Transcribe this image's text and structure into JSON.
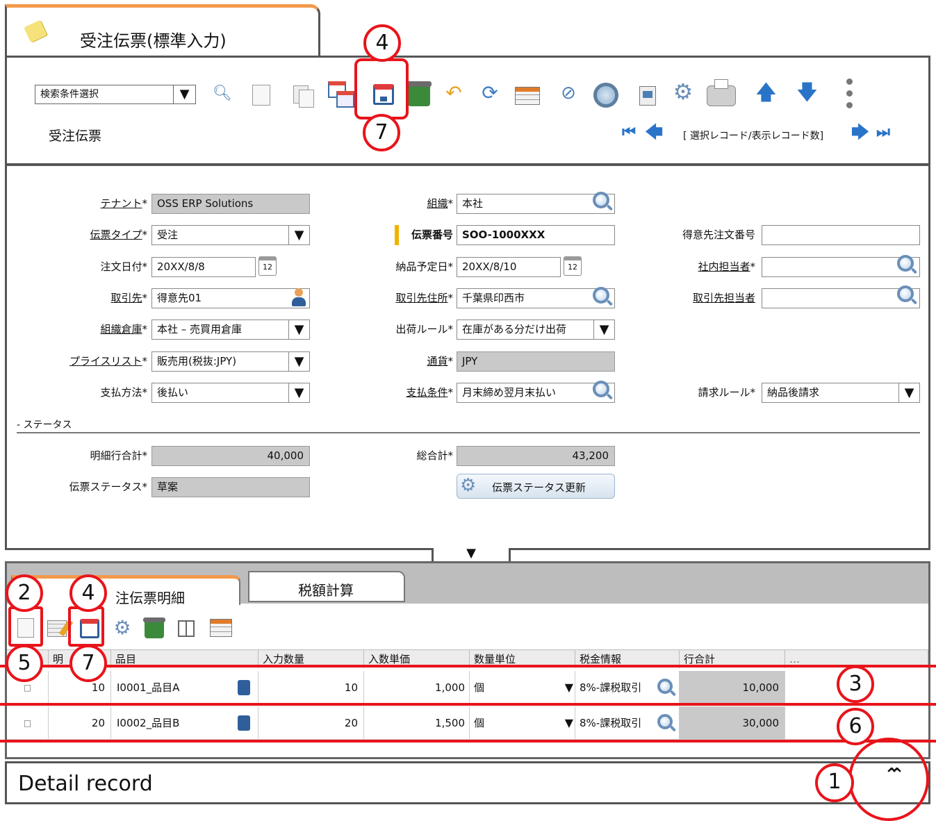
{
  "window": {
    "tab_title": "受注伝票(標準入力)",
    "form_title": "受注伝票"
  },
  "toolbar": {
    "search_select": "検索条件選択",
    "record_info": "[ 選択レコード/表示レコード数]"
  },
  "fields": {
    "tenant": {
      "label": "テナント",
      "value": "OSS ERP Solutions"
    },
    "org": {
      "label": "組織",
      "value": "本社"
    },
    "doc_type": {
      "label": "伝票タイプ",
      "value": "受注"
    },
    "doc_no": {
      "label": "伝票番号",
      "value": "SOO-1000XXX"
    },
    "customer_po": {
      "label": "得意先注文番号",
      "value": ""
    },
    "order_date": {
      "label": "注文日付",
      "value": "20XX/8/8"
    },
    "delivery_date": {
      "label": "納品予定日",
      "value": "20XX/8/10"
    },
    "sales_rep": {
      "label": "社内担当者",
      "value": ""
    },
    "partner": {
      "label": "取引先",
      "value": "得意先01"
    },
    "partner_addr": {
      "label": "取引先住所",
      "value": "千葉県印西市"
    },
    "partner_contact": {
      "label": "取引先担当者",
      "value": ""
    },
    "warehouse": {
      "label": "組織倉庫",
      "value": "本社 – 売買用倉庫"
    },
    "delivery_rule": {
      "label": "出荷ルール",
      "value": "在庫がある分だけ出荷"
    },
    "pricelist": {
      "label": "プライスリスト",
      "value": "販売用(税抜:JPY)"
    },
    "currency": {
      "label": "通貨",
      "value": "JPY"
    },
    "pay_method": {
      "label": "支払方法",
      "value": "後払い"
    },
    "pay_term": {
      "label": "支払条件",
      "value": "月末締め翌月末払い"
    },
    "invoice_rule": {
      "label": "請求ルール",
      "value": "納品後請求"
    },
    "status_section": "- ステータス",
    "lines_total": {
      "label": "明細行合計",
      "value": "40,000"
    },
    "grand_total": {
      "label": "総合計",
      "value": "43,200"
    },
    "doc_status": {
      "label": "伝票ステータス",
      "value": "草案"
    },
    "status_button": "伝票ステータス更新"
  },
  "required_mark": "*",
  "detail": {
    "tabs": [
      "注伝票明細",
      "税額計算"
    ],
    "columns": [
      "明",
      "品目",
      "入力数量",
      "入数単価",
      "数量単位",
      "税金情報",
      "行合計",
      "…"
    ],
    "rows": [
      {
        "check": "□",
        "line": "10",
        "product": "I0001_品目A",
        "qty": "10",
        "price": "1,000",
        "uom": "個",
        "tax": "8%-課税取引",
        "total": "10,000"
      },
      {
        "check": "□",
        "line": "20",
        "product": "I0002_品目B",
        "qty": "20",
        "price": "1,500",
        "uom": "個",
        "tax": "8%-課税取引",
        "total": "30,000"
      }
    ]
  },
  "footer": {
    "label": "Detail record",
    "collapse_icon": "⌃⌃"
  },
  "annotations": {
    "c1": "1",
    "c2": "2",
    "c3": "3",
    "c4a": "4",
    "c4b": "4",
    "c5": "5",
    "c6": "6",
    "c7a": "7",
    "c7b": "7"
  }
}
